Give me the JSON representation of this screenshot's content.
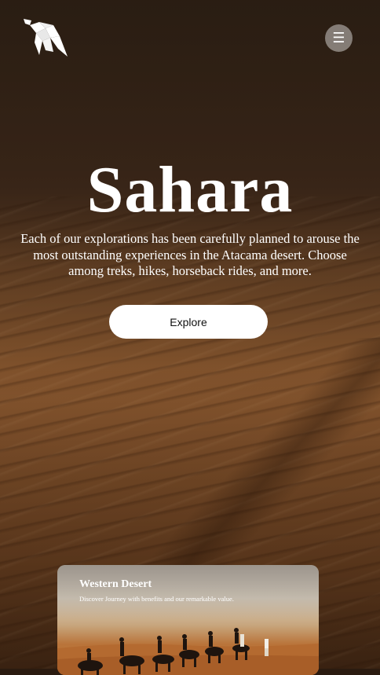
{
  "header": {
    "logo_icon": "origami-camel-logo",
    "menu_icon": "hamburger-menu-icon",
    "menu_glyph": "☰"
  },
  "hero": {
    "title": "Sahara",
    "description": "Each of our explorations has been carefully planned to arouse the most outstanding experiences in the Atacama desert. Choose among treks, hikes, horseback rides, and more.",
    "explore_label": "Explore"
  },
  "card": {
    "title": "Western Desert",
    "subtitle": "Discover Journey with benefits and our remarkable value."
  },
  "colors": {
    "accent": "#ffffff",
    "sand": "#a46a3a",
    "dark": "#2b1b10"
  }
}
